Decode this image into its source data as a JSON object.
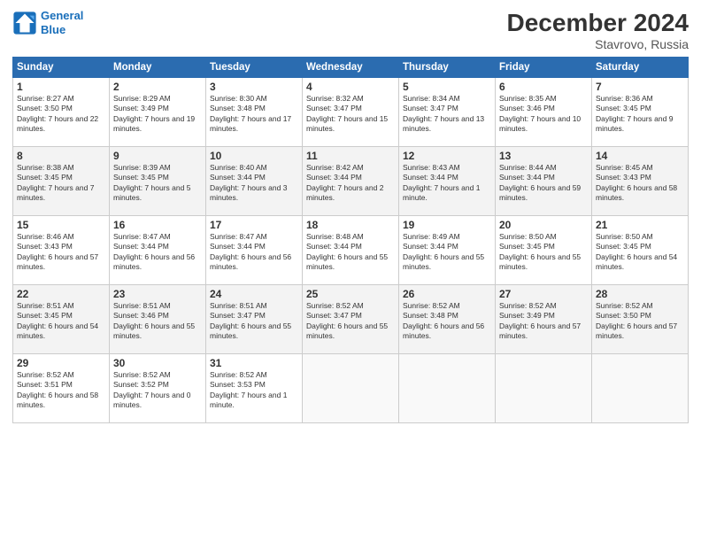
{
  "header": {
    "logo_line1": "General",
    "logo_line2": "Blue",
    "main_title": "December 2024",
    "subtitle": "Stavrovo, Russia"
  },
  "days_of_week": [
    "Sunday",
    "Monday",
    "Tuesday",
    "Wednesday",
    "Thursday",
    "Friday",
    "Saturday"
  ],
  "weeks": [
    [
      {
        "day": "1",
        "sunrise": "Sunrise: 8:27 AM",
        "sunset": "Sunset: 3:50 PM",
        "daylight": "Daylight: 7 hours and 22 minutes."
      },
      {
        "day": "2",
        "sunrise": "Sunrise: 8:29 AM",
        "sunset": "Sunset: 3:49 PM",
        "daylight": "Daylight: 7 hours and 19 minutes."
      },
      {
        "day": "3",
        "sunrise": "Sunrise: 8:30 AM",
        "sunset": "Sunset: 3:48 PM",
        "daylight": "Daylight: 7 hours and 17 minutes."
      },
      {
        "day": "4",
        "sunrise": "Sunrise: 8:32 AM",
        "sunset": "Sunset: 3:47 PM",
        "daylight": "Daylight: 7 hours and 15 minutes."
      },
      {
        "day": "5",
        "sunrise": "Sunrise: 8:34 AM",
        "sunset": "Sunset: 3:47 PM",
        "daylight": "Daylight: 7 hours and 13 minutes."
      },
      {
        "day": "6",
        "sunrise": "Sunrise: 8:35 AM",
        "sunset": "Sunset: 3:46 PM",
        "daylight": "Daylight: 7 hours and 10 minutes."
      },
      {
        "day": "7",
        "sunrise": "Sunrise: 8:36 AM",
        "sunset": "Sunset: 3:45 PM",
        "daylight": "Daylight: 7 hours and 9 minutes."
      }
    ],
    [
      {
        "day": "8",
        "sunrise": "Sunrise: 8:38 AM",
        "sunset": "Sunset: 3:45 PM",
        "daylight": "Daylight: 7 hours and 7 minutes."
      },
      {
        "day": "9",
        "sunrise": "Sunrise: 8:39 AM",
        "sunset": "Sunset: 3:45 PM",
        "daylight": "Daylight: 7 hours and 5 minutes."
      },
      {
        "day": "10",
        "sunrise": "Sunrise: 8:40 AM",
        "sunset": "Sunset: 3:44 PM",
        "daylight": "Daylight: 7 hours and 3 minutes."
      },
      {
        "day": "11",
        "sunrise": "Sunrise: 8:42 AM",
        "sunset": "Sunset: 3:44 PM",
        "daylight": "Daylight: 7 hours and 2 minutes."
      },
      {
        "day": "12",
        "sunrise": "Sunrise: 8:43 AM",
        "sunset": "Sunset: 3:44 PM",
        "daylight": "Daylight: 7 hours and 1 minute."
      },
      {
        "day": "13",
        "sunrise": "Sunrise: 8:44 AM",
        "sunset": "Sunset: 3:44 PM",
        "daylight": "Daylight: 6 hours and 59 minutes."
      },
      {
        "day": "14",
        "sunrise": "Sunrise: 8:45 AM",
        "sunset": "Sunset: 3:43 PM",
        "daylight": "Daylight: 6 hours and 58 minutes."
      }
    ],
    [
      {
        "day": "15",
        "sunrise": "Sunrise: 8:46 AM",
        "sunset": "Sunset: 3:43 PM",
        "daylight": "Daylight: 6 hours and 57 minutes."
      },
      {
        "day": "16",
        "sunrise": "Sunrise: 8:47 AM",
        "sunset": "Sunset: 3:44 PM",
        "daylight": "Daylight: 6 hours and 56 minutes."
      },
      {
        "day": "17",
        "sunrise": "Sunrise: 8:47 AM",
        "sunset": "Sunset: 3:44 PM",
        "daylight": "Daylight: 6 hours and 56 minutes."
      },
      {
        "day": "18",
        "sunrise": "Sunrise: 8:48 AM",
        "sunset": "Sunset: 3:44 PM",
        "daylight": "Daylight: 6 hours and 55 minutes."
      },
      {
        "day": "19",
        "sunrise": "Sunrise: 8:49 AM",
        "sunset": "Sunset: 3:44 PM",
        "daylight": "Daylight: 6 hours and 55 minutes."
      },
      {
        "day": "20",
        "sunrise": "Sunrise: 8:50 AM",
        "sunset": "Sunset: 3:45 PM",
        "daylight": "Daylight: 6 hours and 55 minutes."
      },
      {
        "day": "21",
        "sunrise": "Sunrise: 8:50 AM",
        "sunset": "Sunset: 3:45 PM",
        "daylight": "Daylight: 6 hours and 54 minutes."
      }
    ],
    [
      {
        "day": "22",
        "sunrise": "Sunrise: 8:51 AM",
        "sunset": "Sunset: 3:45 PM",
        "daylight": "Daylight: 6 hours and 54 minutes."
      },
      {
        "day": "23",
        "sunrise": "Sunrise: 8:51 AM",
        "sunset": "Sunset: 3:46 PM",
        "daylight": "Daylight: 6 hours and 55 minutes."
      },
      {
        "day": "24",
        "sunrise": "Sunrise: 8:51 AM",
        "sunset": "Sunset: 3:47 PM",
        "daylight": "Daylight: 6 hours and 55 minutes."
      },
      {
        "day": "25",
        "sunrise": "Sunrise: 8:52 AM",
        "sunset": "Sunset: 3:47 PM",
        "daylight": "Daylight: 6 hours and 55 minutes."
      },
      {
        "day": "26",
        "sunrise": "Sunrise: 8:52 AM",
        "sunset": "Sunset: 3:48 PM",
        "daylight": "Daylight: 6 hours and 56 minutes."
      },
      {
        "day": "27",
        "sunrise": "Sunrise: 8:52 AM",
        "sunset": "Sunset: 3:49 PM",
        "daylight": "Daylight: 6 hours and 57 minutes."
      },
      {
        "day": "28",
        "sunrise": "Sunrise: 8:52 AM",
        "sunset": "Sunset: 3:50 PM",
        "daylight": "Daylight: 6 hours and 57 minutes."
      }
    ],
    [
      {
        "day": "29",
        "sunrise": "Sunrise: 8:52 AM",
        "sunset": "Sunset: 3:51 PM",
        "daylight": "Daylight: 6 hours and 58 minutes."
      },
      {
        "day": "30",
        "sunrise": "Sunrise: 8:52 AM",
        "sunset": "Sunset: 3:52 PM",
        "daylight": "Daylight: 7 hours and 0 minutes."
      },
      {
        "day": "31",
        "sunrise": "Sunrise: 8:52 AM",
        "sunset": "Sunset: 3:53 PM",
        "daylight": "Daylight: 7 hours and 1 minute."
      },
      null,
      null,
      null,
      null
    ]
  ]
}
